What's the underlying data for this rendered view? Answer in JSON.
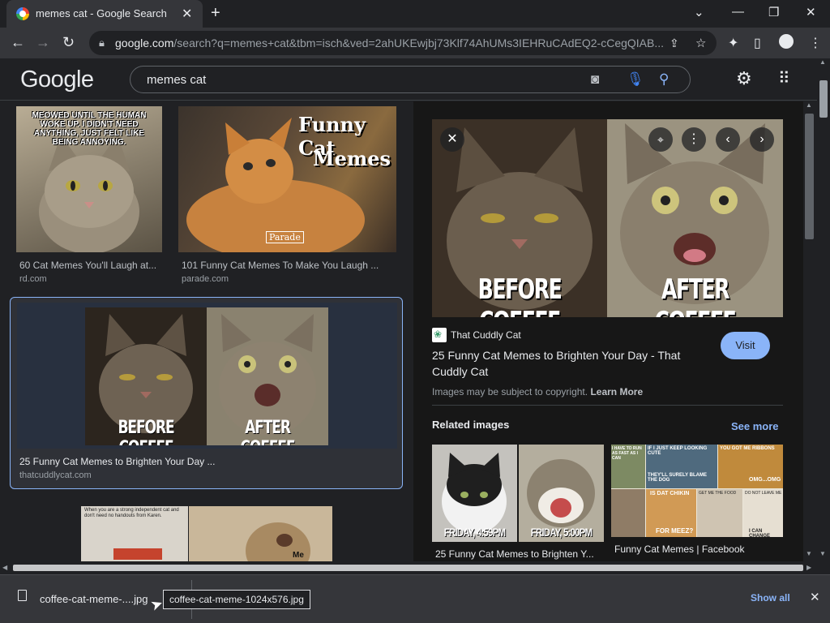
{
  "browser": {
    "tab_title": "memes cat - Google Search",
    "url_host": "google.com",
    "url_path": "/search?q=memes+cat&tbm=isch&ved=2ahUKEwjbj73Klf74AhUMs3IEHRuCAdEQ2-cCegQIAB..."
  },
  "google": {
    "logo": "Google",
    "query": "memes cat"
  },
  "results": [
    {
      "meme_text": "MEOWED UNTIL THE HUMAN WOKE UP. I DIDN'T NEED ANYTHING, JUST FELT LIKE BEING ANNOYING.",
      "caption": "60 Cat Memes You'll Laugh at...",
      "source": "rd.com"
    },
    {
      "meme_text1": "Funny Cat",
      "meme_text2": "Memes",
      "watermark": "Parade",
      "caption": "101 Funny Cat Memes To Make You Laugh ...",
      "source": "parade.com"
    },
    {
      "left_text": "BEFORE COFFEE",
      "right_text": "AFTER COFFEE",
      "caption": "25 Funny Cat Memes to Brighten Your Day ...",
      "source": "thatcuddlycat.com"
    },
    {
      "meme_text": "When you are a strong independent cat and don't need no handouts from Karen.",
      "meme_text2": "Me"
    }
  ],
  "preview": {
    "left_text": "BEFORE COFFEE",
    "right_text": "AFTER COFFEE",
    "site_name": "That Cuddly Cat",
    "title": "25 Funny Cat Memes to Brighten Your Day - That Cuddly Cat",
    "visit_label": "Visit",
    "copyright": "Images may be subject to copyright.",
    "learn_more": "Learn More",
    "related_heading": "Related images",
    "see_more": "See more",
    "related": [
      {
        "caption": "25 Funny Cat Memes to Brighten Y...",
        "left_text": "FRIDAY, 4:59PM",
        "right_text": "FRIDAY, 5:00PM"
      },
      {
        "caption": "Funny Cat Memes | Facebook",
        "texts": [
          "I HAVE TO RUN AS FAST AS I CAN",
          "IF I JUST KEEP LOOKING CUTE",
          "YOU GOT ME RIBBONS",
          "THEY'LL SURELY BLAME THE DOG",
          "OMG...OMG",
          "IS DAT CHIKIN",
          "GET ME THE FOOD",
          "DO NOT LEAVE ME",
          "FOR MEEZ?",
          "I CAN CHANGE"
        ]
      }
    ]
  },
  "downloads": {
    "file_label": "coffee-cat-meme-....jpg",
    "tooltip": "coffee-cat-meme-1024x576.jpg",
    "show_all": "Show all"
  },
  "colors": {
    "accent": "#8ab4f8",
    "visit_bg": "#8ab4f8",
    "selected_border": "#8ab4f8"
  }
}
